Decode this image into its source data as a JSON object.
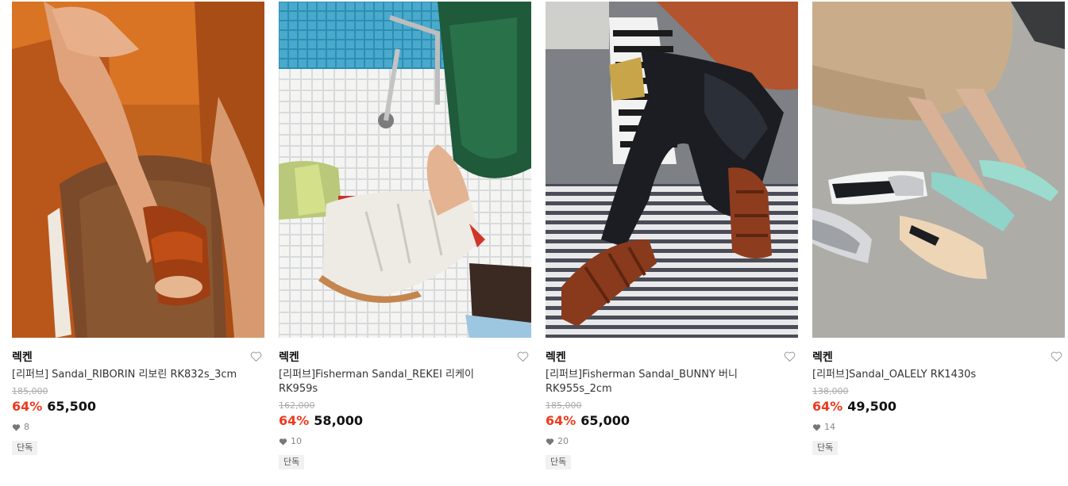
{
  "products": [
    {
      "brand": "렉켄",
      "title": "[리퍼브] Sandal_RIBORIN 리보린 RK832s_3cm",
      "original_price": "185,000",
      "discount": "64%",
      "price": "65,500",
      "likes": "8",
      "badge": "단독",
      "image_theme": "orange-leather-sandal-photo",
      "like_icon": "heart-outline-icon"
    },
    {
      "brand": "렉켄",
      "title": "[리퍼브]Fisherman Sandal_REKEI 리케이 RK959s",
      "original_price": "162,000",
      "discount": "64%",
      "price": "58,000",
      "likes": "10",
      "badge": "단독",
      "image_theme": "white-fisherman-sandal-photo",
      "like_icon": "heart-outline-icon"
    },
    {
      "brand": "렉켄",
      "title": "[리퍼브]Fisherman Sandal_BUNNY 버니 RK955s_2cm",
      "original_price": "185,000",
      "discount": "64%",
      "price": "65,000",
      "likes": "20",
      "badge": "단독",
      "image_theme": "brown-fisherman-sandal-photo",
      "like_icon": "heart-outline-icon"
    },
    {
      "brand": "렉켄",
      "title": "[리퍼브]Sandal_OALELY RK1430s",
      "original_price": "138,000",
      "discount": "64%",
      "price": "49,500",
      "likes": "14",
      "badge": "단독",
      "image_theme": "mint-toe-ring-sandal-photo",
      "like_icon": "heart-outline-icon"
    }
  ],
  "colors": {
    "discount": "#ee3a1d",
    "badge_bg": "#f1f1f1",
    "strike": "#aaaaaa"
  }
}
